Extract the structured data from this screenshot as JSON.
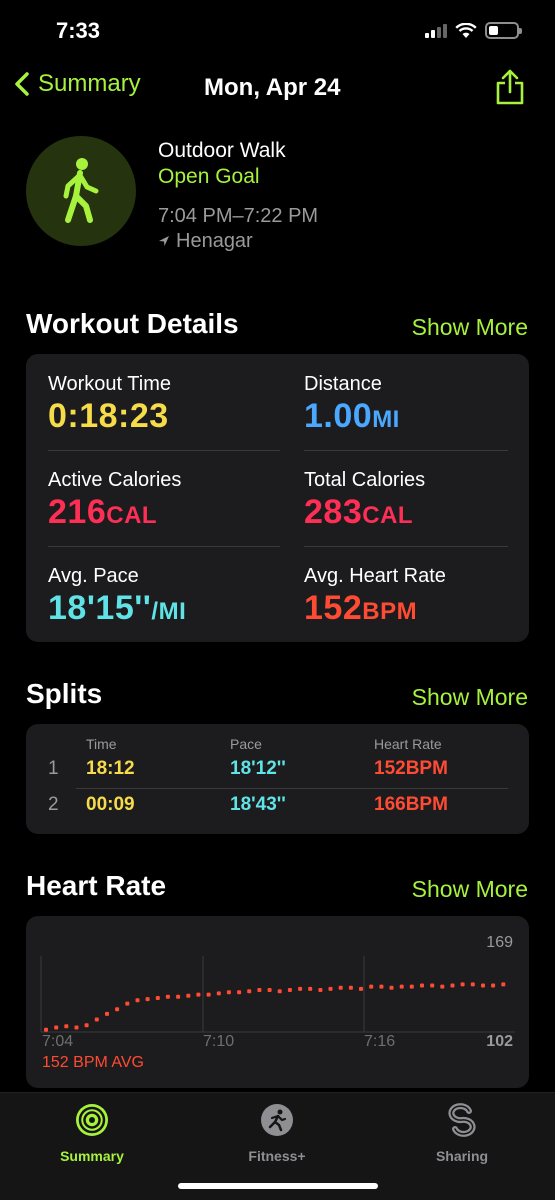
{
  "status": {
    "time": "7:33"
  },
  "nav": {
    "back_label": "Summary",
    "title": "Mon, Apr 24"
  },
  "workout": {
    "name": "Outdoor Walk",
    "goal": "Open Goal",
    "time_range": "7:04 PM–7:22 PM",
    "location": "Henagar"
  },
  "details": {
    "title": "Workout Details",
    "show_more": "Show More",
    "metrics": [
      {
        "label": "Workout Time",
        "value": "0:18:23",
        "unit": "",
        "color": "#f7dc4a"
      },
      {
        "label": "Distance",
        "value": "1.00",
        "unit": "MI",
        "color": "#4aa8ff"
      },
      {
        "label": "Active Calories",
        "value": "216",
        "unit": "CAL",
        "color": "#ff2e55"
      },
      {
        "label": "Total Calories",
        "value": "283",
        "unit": "CAL",
        "color": "#ff2e55"
      },
      {
        "label": "Avg. Pace",
        "value": "18'15''",
        "unit": "/MI",
        "color": "#5fe3e6"
      },
      {
        "label": "Avg. Heart Rate",
        "value": "152",
        "unit": "BPM",
        "color": "#ff4b33"
      }
    ]
  },
  "splits": {
    "title": "Splits",
    "show_more": "Show More",
    "headers": [
      "Time",
      "Pace",
      "Heart Rate"
    ],
    "rows": [
      {
        "num": "1",
        "time": "18:12",
        "pace": "18'12''",
        "hr": "152",
        "hr_unit": "BPM"
      },
      {
        "num": "2",
        "time": "00:09",
        "pace": "18'43''",
        "hr": "166",
        "hr_unit": "BPM"
      }
    ]
  },
  "heart_rate": {
    "title": "Heart Rate",
    "show_more": "Show More",
    "max_label": "169",
    "min_label": "102",
    "ticks": [
      "7:04",
      "7:10",
      "7:16"
    ],
    "avg_label": "152 BPM AVG"
  },
  "tabs": [
    {
      "label": "Summary",
      "icon": "activity-rings-icon",
      "active": true
    },
    {
      "label": "Fitness+",
      "icon": "running-figure-icon",
      "active": false
    },
    {
      "label": "Sharing",
      "icon": "sharing-icon",
      "active": false
    }
  ],
  "colors": {
    "accent": "#a6f23c",
    "yellow": "#f7dc4a",
    "blue": "#4aa8ff",
    "red": "#ff2e55",
    "cyan": "#5fe3e6",
    "orange_red": "#ff4b33"
  },
  "chart_data": {
    "type": "scatter",
    "title": "",
    "xlabel": "",
    "ylabel": "",
    "ylim": [
      102,
      169
    ],
    "x_ticks": [
      "7:04",
      "7:10",
      "7:16"
    ],
    "series": [
      {
        "name": "",
        "x": [
          0,
          0.4,
          0.8,
          1.2,
          1.6,
          2.0,
          2.4,
          2.8,
          3.2,
          3.6,
          4.0,
          4.4,
          4.8,
          5.2,
          5.6,
          6.0,
          6.4,
          6.8,
          7.2,
          7.6,
          8.0,
          8.4,
          8.8,
          9.2,
          9.6,
          10.0,
          10.4,
          10.8,
          11.2,
          11.6,
          12.0,
          12.4,
          12.8,
          13.2,
          13.6,
          14.0,
          14.4,
          14.8,
          15.2,
          15.6,
          16.0,
          16.4,
          16.8,
          17.2,
          17.6,
          18.0
        ],
        "values": [
          104,
          106,
          107,
          106,
          108,
          113,
          118,
          122,
          127,
          130,
          131,
          132,
          133,
          133,
          134,
          135,
          135,
          136,
          137,
          137,
          138,
          139,
          139,
          138,
          139,
          140,
          140,
          139,
          140,
          141,
          141,
          140,
          142,
          142,
          141,
          142,
          142,
          143,
          143,
          142,
          143,
          144,
          144,
          143,
          143,
          144
        ]
      }
    ]
  }
}
